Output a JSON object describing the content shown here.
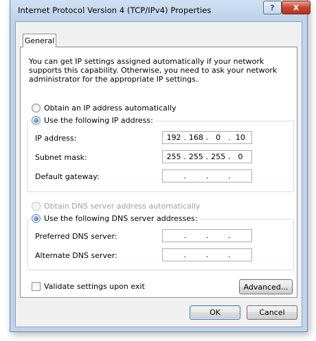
{
  "window": {
    "title": "Internet Protocol Version 4 (TCP/IPv4) Properties",
    "help_label": "?",
    "close_label": "X"
  },
  "tabs": [
    {
      "label": "General"
    }
  ],
  "intro_text": "You can get IP settings assigned automatically if your network supports this capability. Otherwise, you need to ask your network administrator for the appropriate IP settings.",
  "ip_section": {
    "auto_label": "Obtain an IP address automatically",
    "manual_label": "Use the following IP address:",
    "selected": "manual",
    "fields": [
      {
        "label": "IP address:",
        "octets": [
          "192",
          "168",
          "0",
          "10"
        ]
      },
      {
        "label": "Subnet mask:",
        "octets": [
          "255",
          "255",
          "255",
          "0"
        ]
      },
      {
        "label": "Default gateway:",
        "octets": [
          "",
          "",
          "",
          ""
        ]
      }
    ]
  },
  "dns_section": {
    "auto_label": "Obtain DNS server address automatically",
    "auto_enabled": false,
    "manual_label": "Use the following DNS server addresses:",
    "selected": "manual",
    "fields": [
      {
        "label": "Preferred DNS server:",
        "octets": [
          "",
          "",
          "",
          ""
        ]
      },
      {
        "label": "Alternate DNS server:",
        "octets": [
          "",
          "",
          "",
          ""
        ]
      }
    ]
  },
  "validate": {
    "label": "Validate settings upon exit",
    "checked": false
  },
  "buttons": {
    "advanced": "Advanced...",
    "ok": "OK",
    "cancel": "Cancel"
  },
  "colors": {
    "frame": "#bfd4ea",
    "close": "#c8452f",
    "radio_selected": "#1f5fb8"
  }
}
